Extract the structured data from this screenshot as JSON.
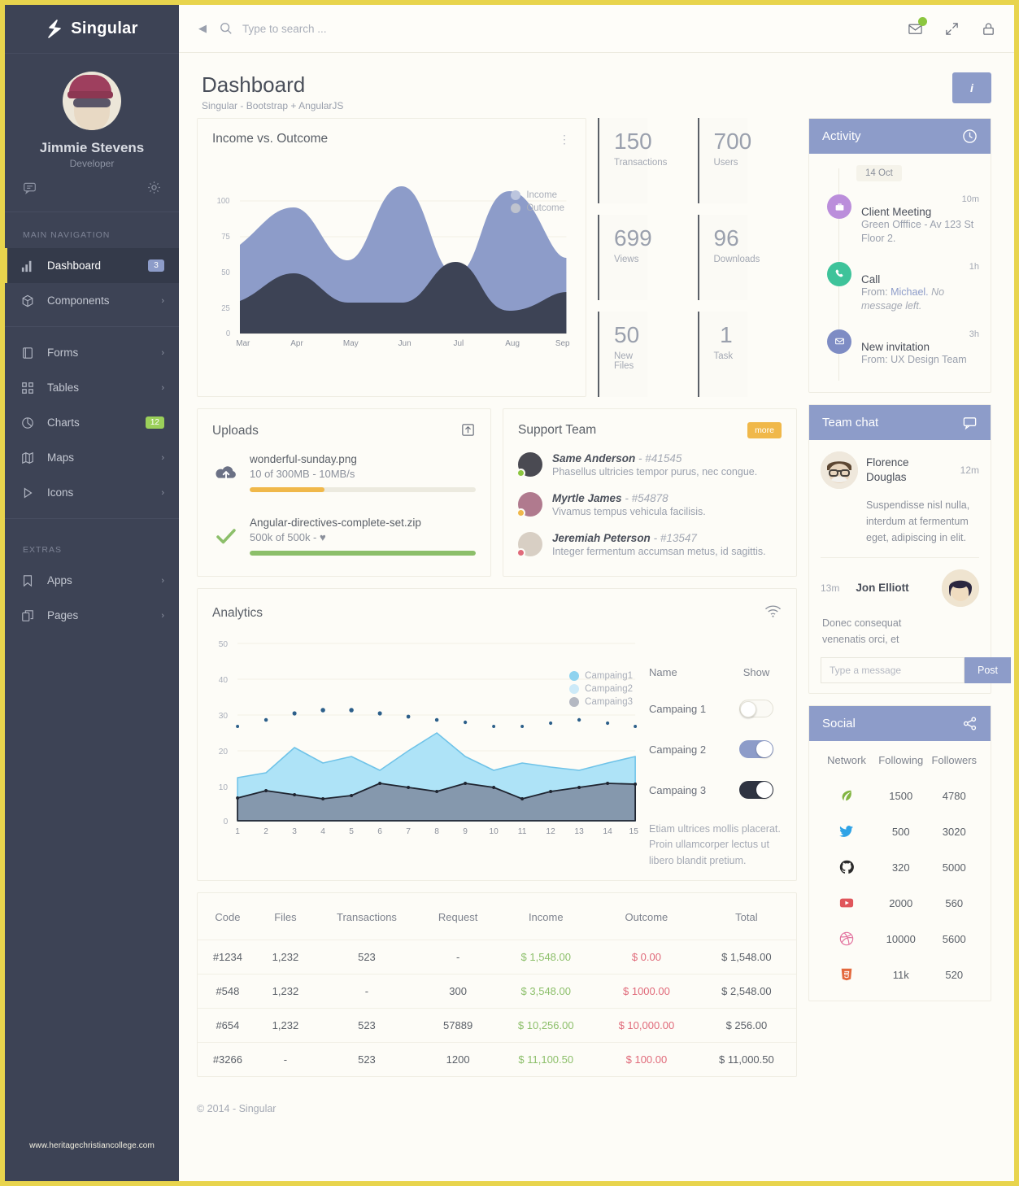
{
  "brand": {
    "name": "Singular"
  },
  "profile": {
    "name": "Jimmie Stevens",
    "role": "Developer"
  },
  "sidebar": {
    "section_main": "MAIN NAVIGATION",
    "section_extras": "EXTRAS",
    "items": [
      {
        "label": "Dashboard",
        "icon": "bar-chart-icon",
        "badge": "3",
        "badge_color": "#8d9cc9",
        "active": true
      },
      {
        "label": "Components",
        "icon": "cube-icon",
        "chevron": "›"
      },
      {
        "label": "Forms",
        "icon": "form-icon",
        "chevron": "›"
      },
      {
        "label": "Tables",
        "icon": "grid-icon",
        "chevron": "›"
      },
      {
        "label": "Charts",
        "icon": "pie-chart-icon",
        "badge": "12",
        "badge_color": "#9bd05a"
      },
      {
        "label": "Maps",
        "icon": "map-icon",
        "chevron": "›"
      },
      {
        "label": "Icons",
        "icon": "play-icon",
        "chevron": "›"
      }
    ],
    "extras": [
      {
        "label": "Apps",
        "icon": "bookmark-icon",
        "chevron": "›"
      },
      {
        "label": "Pages",
        "icon": "pages-icon",
        "chevron": "›"
      }
    ],
    "watermark": "www.heritagechristiancollege.com"
  },
  "topbar": {
    "search_placeholder": "Type to search ..."
  },
  "page": {
    "title": "Dashboard",
    "subtitle": "Singular - Bootstrap + AngularJS",
    "info_label": "i"
  },
  "income_card": {
    "title": "Income vs. Outcome"
  },
  "stats": [
    {
      "num": "150",
      "label": "Transactions",
      "align": "left"
    },
    {
      "num": "700",
      "label": "Users",
      "align": "right"
    },
    {
      "num": "699",
      "label": "Views",
      "align": "right"
    },
    {
      "num": "96",
      "label": "Downloads",
      "align": "right"
    },
    {
      "num": "50",
      "label": "New Files",
      "align": "left"
    },
    {
      "num": "1",
      "label": "Task",
      "align": "right"
    }
  ],
  "uploads": {
    "title": "Uploads",
    "items": [
      {
        "name": "wonderful-sunday.png",
        "meta": "10 of 300MB - 10MB/s",
        "progress": 33,
        "color": "#f0b84a",
        "state": "uploading"
      },
      {
        "name": "Angular-directives-complete-set.zip",
        "meta": "500k of 500k - ♥",
        "progress": 100,
        "color": "#8cbf6a",
        "state": "done"
      }
    ]
  },
  "support": {
    "title": "Support Team",
    "more_label": "more",
    "members": [
      {
        "name": "Same Anderson",
        "id": "- #41545",
        "text": "Phasellus ultricies tempor purus, nec congue.",
        "status": "#8cc63f"
      },
      {
        "name": "Myrtle James",
        "id": "- #54878",
        "text": "Vivamus tempus vehicula facilisis.",
        "status": "#f0b84a"
      },
      {
        "name": "Jeremiah Peterson",
        "id": "- #13547",
        "text": "Integer fermentum accumsan metus, id sagittis.",
        "status": "#e06a7a"
      }
    ]
  },
  "analytics": {
    "title": "Analytics",
    "col_name": "Name",
    "col_show": "Show",
    "rows": [
      {
        "label": "Campaing 1",
        "on": false,
        "style": "off"
      },
      {
        "label": "Campaing 2",
        "on": true,
        "style": "on-blue"
      },
      {
        "label": "Campaing 3",
        "on": true,
        "style": "on-dark"
      }
    ],
    "note": "Etiam ultrices mollis placerat. Proin ullamcorper lectus ut libero blandit pretium."
  },
  "table": {
    "headers": [
      "Code",
      "Files",
      "Transactions",
      "Request",
      "Income",
      "Outcome",
      "Total"
    ],
    "rows": [
      {
        "code": "#1234",
        "files": "1,232",
        "transactions": "523",
        "request": "-",
        "income": "$ 1,548.00",
        "outcome": "$ 0.00",
        "total": "$ 1,548.00"
      },
      {
        "code": "#548",
        "files": "1,232",
        "transactions": "-",
        "request": "300",
        "income": "$ 3,548.00",
        "outcome": "$ 1000.00",
        "total": "$ 2,548.00"
      },
      {
        "code": "#654",
        "files": "1,232",
        "transactions": "523",
        "request": "57889",
        "income": "$ 10,256.00",
        "outcome": "$ 10,000.00",
        "total": "$ 256.00"
      },
      {
        "code": "#3266",
        "files": "-",
        "transactions": "523",
        "request": "1200",
        "income": "$ 11,100.50",
        "outcome": "$ 100.00",
        "total": "$ 11,000.50"
      }
    ]
  },
  "activity": {
    "title": "Activity",
    "date": "14 Oct",
    "items": [
      {
        "time": "10m",
        "title": "Client Meeting",
        "text": "Green Offfice - Av 123 St Floor 2.",
        "color": "#bb8edb",
        "icon": "briefcase-icon"
      },
      {
        "time": "1h",
        "title": "Call",
        "text_pre": "From: ",
        "link": "Michael.",
        "text_it": " No message left.",
        "color": "#3ec39a",
        "icon": "phone-icon"
      },
      {
        "time": "3h",
        "title": "New invitation",
        "text": "From: UX Design Team",
        "color": "#7e8cc4",
        "icon": "envelope-icon"
      }
    ]
  },
  "teamchat": {
    "title": "Team chat",
    "messages": [
      {
        "name": "Florence Douglas",
        "time": "12m",
        "text": "Suspendisse nisl nulla, interdum at fermentum eget, adipiscing in elit.",
        "side": "left"
      },
      {
        "name": "Jon Elliott",
        "time": "13m",
        "text": "Donec consequat venenatis orci, et",
        "side": "right"
      }
    ],
    "input_placeholder": "Type a message",
    "post_label": "Post"
  },
  "social": {
    "title": "Social",
    "headers": [
      "Network",
      "Following",
      "Followers"
    ],
    "rows": [
      {
        "network": "envato-icon",
        "color": "#82b541",
        "following": "1500",
        "followers": "4780"
      },
      {
        "network": "twitter-icon",
        "color": "#2fa3e6",
        "following": "500",
        "followers": "3020"
      },
      {
        "network": "github-icon",
        "color": "#2b2b2b",
        "following": "320",
        "followers": "5000"
      },
      {
        "network": "youtube-icon",
        "color": "#e0565b",
        "following": "2000",
        "followers": "560"
      },
      {
        "network": "dribbble-icon",
        "color": "#e2719e",
        "following": "10000",
        "followers": "5600"
      },
      {
        "network": "html5-icon",
        "color": "#e3683c",
        "following": "11k",
        "followers": "520"
      }
    ]
  },
  "footer": {
    "text": "© 2014 - Singular"
  },
  "chart_data": [
    {
      "id": "income-vs-outcome",
      "type": "area",
      "title": "Income vs. Outcome",
      "xlabel": "",
      "ylabel": "",
      "categories": [
        "Mar",
        "Apr",
        "May",
        "Jun",
        "Jul",
        "Aug",
        "Sep"
      ],
      "ylim": [
        0,
        100
      ],
      "yticks": [
        0,
        25,
        50,
        75,
        100
      ],
      "grid": true,
      "legend_position": "top-right",
      "series": [
        {
          "name": "Income",
          "color": "#8d9cc9",
          "values": [
            62,
            80,
            61,
            91,
            66,
            99,
            52
          ]
        },
        {
          "name": "Outcome",
          "color": "#3d4355",
          "values": [
            23,
            42,
            35,
            22,
            50,
            16,
            29
          ]
        }
      ]
    },
    {
      "id": "analytics",
      "type": "area",
      "title": "Analytics",
      "x": [
        1,
        2,
        3,
        4,
        5,
        6,
        7,
        8,
        9,
        10,
        11,
        12,
        13,
        14,
        15
      ],
      "ylim": [
        0,
        50
      ],
      "yticks": [
        0,
        10,
        20,
        30,
        40,
        50
      ],
      "grid": true,
      "legend_position": "top-right",
      "series": [
        {
          "name": "Campaing1",
          "color": "#6fc3e8",
          "type": "area",
          "values": [
            12,
            14,
            20.5,
            16,
            18,
            14,
            19.5,
            24.5,
            18,
            14,
            16,
            15,
            14,
            16,
            18
          ]
        },
        {
          "name": "Campaing2",
          "color": "#aee3f7",
          "type": "area",
          "values": [
            6.3,
            8.5,
            7.3,
            6.2,
            7.2,
            10.4,
            9.3,
            8.2,
            10.4,
            9.3,
            6.1,
            8.2,
            9.3,
            10.4,
            10.3
          ]
        },
        {
          "name": "Campaing3",
          "color": "#9aa0ad",
          "type": "scatter",
          "values": [
            28.5,
            30.2,
            32,
            33,
            33,
            32,
            31,
            30.2,
            29.5,
            28.6,
            28.6,
            29.5,
            30.2,
            29.5,
            28.6
          ]
        }
      ]
    }
  ]
}
